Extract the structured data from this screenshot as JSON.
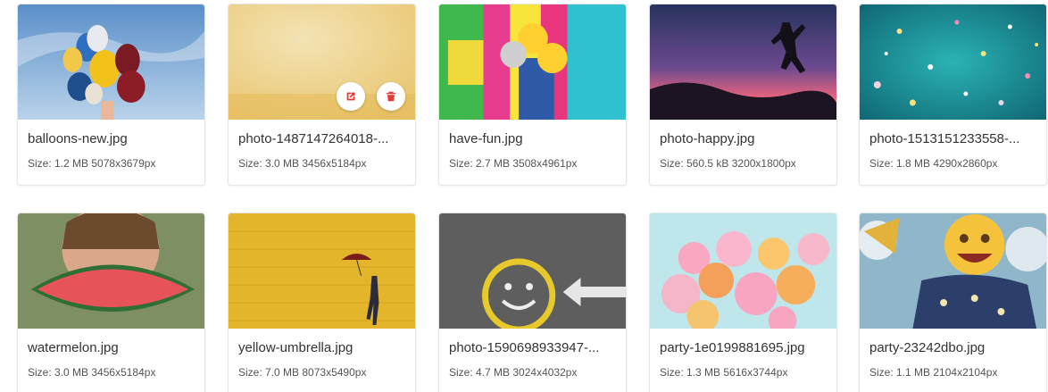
{
  "accent_color": "#e53935",
  "images": [
    {
      "name": "balloons-new.jpg",
      "size": "Size: 1.2 MB",
      "dims": "5078x3679px",
      "thumb": "balloons-image"
    },
    {
      "name": "photo-1487147264018-...",
      "size": "Size: 3.0 MB",
      "dims": "3456x5184px",
      "thumb": "yellow-wall-image",
      "actions": {
        "open_icon": "open-external-icon",
        "delete_icon": "trash-icon"
      }
    },
    {
      "name": "have-fun.jpg",
      "size": "Size: 2.7 MB",
      "dims": "3508x4961px",
      "thumb": "colorful-wall-image"
    },
    {
      "name": "photo-happy.jpg",
      "size": "Size: 560.5 kB",
      "dims": "3200x1800px",
      "thumb": "sunset-jump-image"
    },
    {
      "name": "photo-1513151233558-...",
      "size": "Size: 1.8 MB",
      "dims": "4290x2860px",
      "thumb": "confetti-image"
    },
    {
      "name": "watermelon.jpg",
      "size": "Size: 3.0 MB",
      "dims": "3456x5184px",
      "thumb": "watermelon-image"
    },
    {
      "name": "yellow-umbrella.jpg",
      "size": "Size: 7.0 MB",
      "dims": "8073x5490px",
      "thumb": "yellow-umbrella-image"
    },
    {
      "name": "photo-1590698933947-...",
      "size": "Size: 4.7 MB",
      "dims": "3024x4032px",
      "thumb": "smiley-asphalt-image"
    },
    {
      "name": "party-1e0199881695.jpg",
      "size": "Size: 1.3 MB",
      "dims": "5616x3744px",
      "thumb": "party-balloons-image"
    },
    {
      "name": "party-23242dbo.jpg",
      "size": "Size: 1.1 MB",
      "dims": "2104x2104px",
      "thumb": "emoji-party-image"
    }
  ]
}
